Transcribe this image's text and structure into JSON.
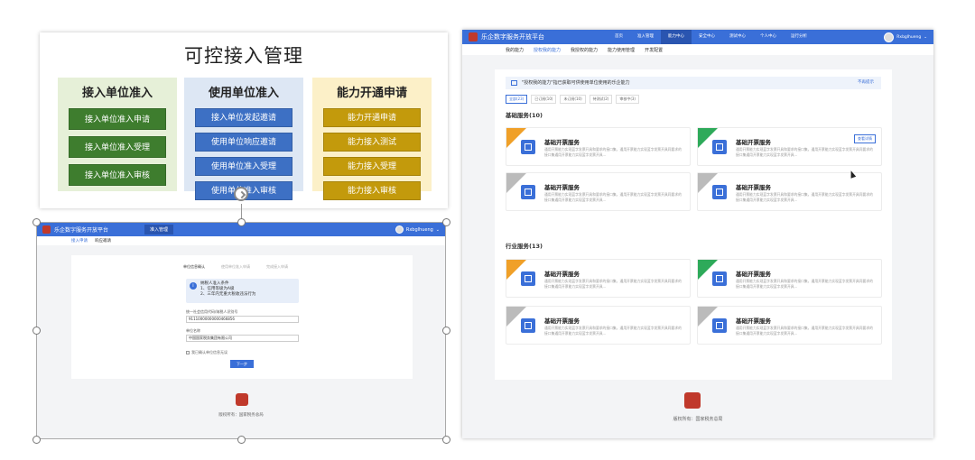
{
  "slide": {
    "title": "可控接入管理",
    "columns": [
      {
        "title": "接入单位准入",
        "items": [
          "接入单位准入申请",
          "接入单位准入受理",
          "接入单位准入审核"
        ]
      },
      {
        "title": "使用单位准入",
        "items": [
          "单位发起邀请",
          "使用单位响应邀请",
          "使用单位准入受理",
          "使用单位准入审核"
        ]
      },
      {
        "title": "能力开通申请",
        "items": [
          "能力开通申请",
          "能力接入测试",
          "能力接入受理",
          "能力接入审核"
        ]
      }
    ]
  },
  "left_shot": {
    "brand": "乐企数字服务开放平台",
    "nav_tab": "准入管理",
    "user": "Rxbglhueng",
    "subnav": [
      "接入申请",
      "响应邀请"
    ],
    "steps": [
      "单位信息确认",
      "使用单位准入申请",
      "完成接入申请"
    ],
    "notice_title": "纳税人准入条件",
    "notice_lines": [
      "1、信用等级为A级",
      "2、三年内无重大税收违法行为"
    ],
    "field1_label": "统一社会信用代码/纳税人识别号",
    "field1_value": "91110000000000466856",
    "field2_label": "单位名称",
    "field2_value": "中国国家税务集团有限公司",
    "checkbox": "我已确认单位信息无误",
    "next_button": "下一步",
    "footer": "版权所有：国家税务总局"
  },
  "right_shot": {
    "brand": "乐企数字服务开放平台",
    "nav": [
      "首页",
      "准入管理",
      "能力中心",
      "安全中心",
      "测试中心",
      "个人中心",
      "运行分析"
    ],
    "nav_active": 2,
    "user": "Rxbglhueng",
    "subnav": [
      "我的能力",
      "授权我的能力",
      "我授权的能力",
      "能力使用管理",
      "开发配置"
    ],
    "subnav_active": 1,
    "tip": "\"授权我的能力\"指已获取可供使用单位使用的乐企能力",
    "tip_close": "不再提示",
    "filters": [
      "全部(23)",
      "已订阅(10)",
      "未订阅(10)",
      "待测试(2)",
      "审核中(3)"
    ],
    "section1": "基础服务(10)",
    "section2": "行业服务(13)",
    "service_name": "基础开票服务",
    "service_desc": "通用开票能力实现蓝字发票开具和要求的接口集，通用开票能力实现蓝字发票开具同要求的接口集通用开票能力实现蓝字发票开具...",
    "detail_button": "查看详情",
    "footer": "版权所有：国家税务总局"
  }
}
